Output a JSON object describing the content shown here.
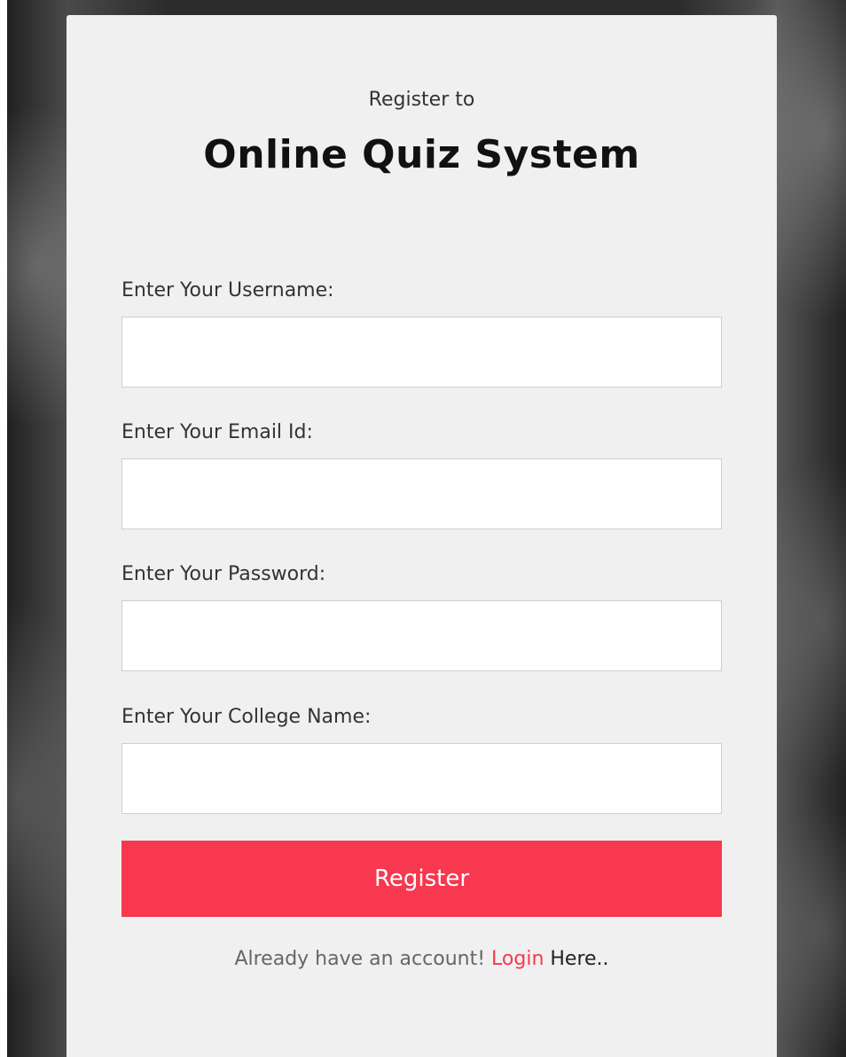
{
  "header": {
    "subtitle": "Register to",
    "title": "Online Quiz System"
  },
  "form": {
    "fields": [
      {
        "label": "Enter Your Username:",
        "value": "",
        "placeholder": ""
      },
      {
        "label": "Enter Your Email Id:",
        "value": "",
        "placeholder": ""
      },
      {
        "label": "Enter Your Password:",
        "value": "",
        "placeholder": ""
      },
      {
        "label": "Enter Your College Name:",
        "value": "",
        "placeholder": ""
      }
    ],
    "submit_label": "Register"
  },
  "footer": {
    "prefix": "Already have an account! ",
    "link_label": "Login",
    "suffix": " Here.."
  },
  "colors": {
    "accent": "#f7384f",
    "card_background": "#f0f0f0"
  }
}
